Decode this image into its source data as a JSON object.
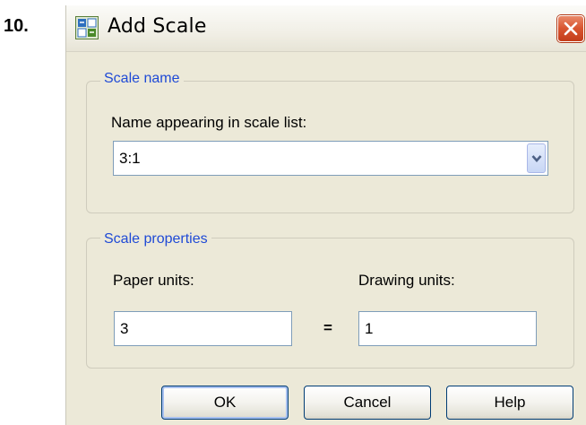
{
  "step_number": "10.",
  "window": {
    "title": "Add Scale",
    "icon": "autocad-scale-icon",
    "close_icon": "close-icon"
  },
  "scale_name_group": {
    "legend": "Scale name",
    "name_label": "Name appearing in scale list:",
    "name_value": "3:1"
  },
  "scale_properties_group": {
    "legend": "Scale properties",
    "paper_units_label": "Paper units:",
    "paper_units_value": "3",
    "equals": "=",
    "drawing_units_label": "Drawing units:",
    "drawing_units_value": "1"
  },
  "buttons": {
    "ok": "OK",
    "cancel": "Cancel",
    "help": "Help"
  },
  "colors": {
    "group_legend": "#1f4ad6",
    "dialog_background": "#ece9d8",
    "close_button": "#d8542f"
  }
}
